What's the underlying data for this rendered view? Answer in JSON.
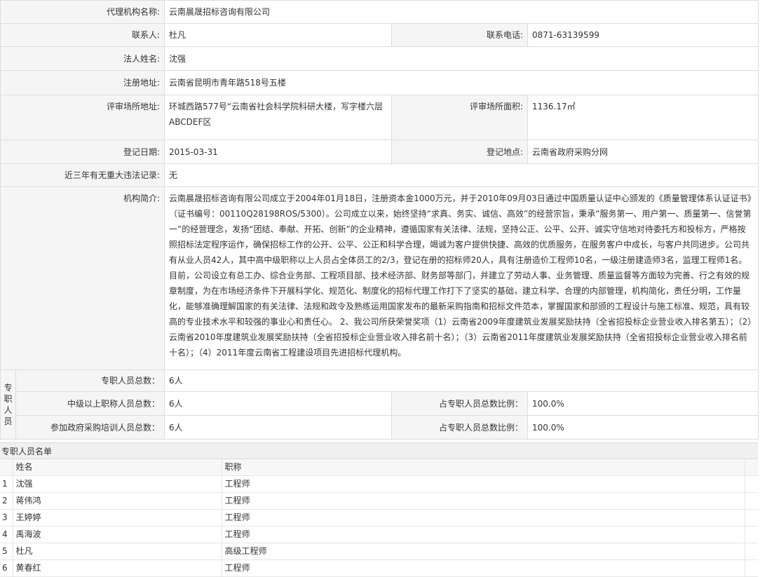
{
  "labels": {
    "agency_name": "代理机构名称:",
    "contact": "联系人:",
    "phone": "联系电话:",
    "legal_person": "法人姓名:",
    "reg_address": "注册地址:",
    "review_address": "评审场所地址:",
    "review_area": "评审场所面积:",
    "reg_date": "登记日期:",
    "reg_place": "登记地点:",
    "violation": "近三年有无重大违法记录:",
    "intro": "机构简介:",
    "staff_group": "专职人员",
    "staff_total": "专职人员总数：",
    "mid_title": "中级以上职称人员总数：",
    "gov_training": "参加政府采购培训人员总数：",
    "ratio1": "占专职人员总数比例：",
    "ratio2": "占专职人员总数比例："
  },
  "values": {
    "agency_name": "云南晨晟招标咨询有限公司",
    "contact": "杜凡",
    "phone": "0871-63139599",
    "legal_person": "沈强",
    "reg_address": "云南省昆明市青年路518号五楼",
    "review_address": "环城西路577号“云南省社会科学院科研大楼，写字楼六层ABCDEF区",
    "review_area": "1136.17㎡",
    "reg_date": "2015-03-31",
    "reg_place": "云南省政府采购分网",
    "violation": "无",
    "intro": "云南晨晟招标咨询有限公司成立于2004年01月18日，注册资本金1000万元，并于2010年09月03日通过中国质量认证中心颁发的《质量管理体系认证证书》（证书编号：00110Q28198ROS/5300）。公司成立以来，始终坚持“求真、务实、诚信、高效”的经营宗旨，秉承“服务第一、用户第一、质量第一、信誉第一”的经营理念，发扬“团结、奉献、开拓、创新”的企业精神，遵循国家有关法律、法规，坚持公正、公平、公开、诚实守信地对待委托方和投标方，严格按照招标法定程序运作，确保招标工作的公开、公平、公正和科学合理，竭诚为客户提供快捷、高效的优质服务，在服务客户中成长，与客户共同进步。公司共有从业人员42人，其中高中级职称以上人员占全体员工的2/3，登记在册的招标师20人，具有注册造价工程师10名，一级注册建造师3名，监理工程师1名。目前，公司设立有总工办、综合业务部、工程项目部、技术经济部、财务部等部门，并建立了劳动人事、业务管理、质量监督等方面较为完善、行之有效的规章制度，为在市场经济条件下开展科学化、规范化、制度化的招标代理工作打下了坚实的基础，建立科学、合理的内部管理，机构简化，责任分明，工作量化，能够准确理解国家的有关法律、法规和政令及熟练运用国家发布的最新采购指南和招标文件范本，掌握国家和部颁的工程设计与施工标准、规范，具有较高的专业技术水平和较强的事业心和责任心。 2、我公司所获荣誉奖项（1）云南省2009年度建筑业发展奖励扶持（全省招投标企业营业收入排名第五）；（2）云南省2010年度建筑业发展奖励扶持（全省招投标企业营业收入排名前十名）；（3）云南省2011年度建筑业发展奖励扶持（全省招投标企业营业收入排名前十名）；（4）2011年度云南省工程建设项目先进招标代理机构。",
    "staff_total": "6人",
    "mid_title": "6人",
    "gov_training": "6人",
    "ratio1": "100.0%",
    "ratio2": "100.0%"
  },
  "staff_list": {
    "title": "专职人员名单",
    "col_name": "姓名",
    "col_title": "职称",
    "rows": [
      {
        "no": "1",
        "name": "沈强",
        "title": "工程师"
      },
      {
        "no": "2",
        "name": "蒋伟鸿",
        "title": "工程师"
      },
      {
        "no": "3",
        "name": "王婷婷",
        "title": "工程师"
      },
      {
        "no": "4",
        "name": "禹海波",
        "title": "工程师"
      },
      {
        "no": "5",
        "name": "杜凡",
        "title": "高级工程师"
      },
      {
        "no": "6",
        "name": "黄春红",
        "title": "工程师"
      }
    ]
  }
}
